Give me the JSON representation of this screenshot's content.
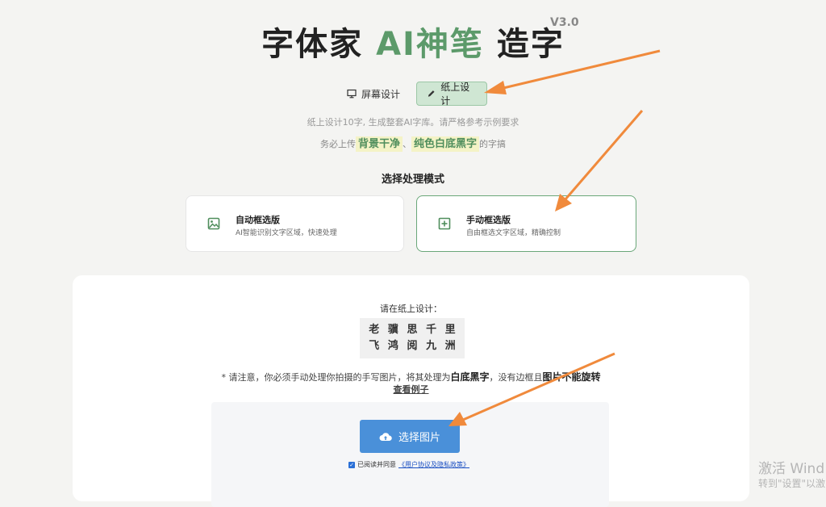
{
  "header": {
    "title_part1": "字体家 ",
    "title_ai": "AI神笔",
    "title_part2": " 造字",
    "version": "V3.0"
  },
  "tabs": [
    {
      "label": "屏幕设计",
      "icon": "monitor-icon",
      "active": false
    },
    {
      "label": "纸上设计",
      "icon": "pencil-icon",
      "active": true
    }
  ],
  "hints": {
    "line1": "纸上设计10字, 生成整套AI字库。请严格参考示例要求",
    "line2_prefix": "务必上传",
    "highlight1": "背景干净",
    "separator": "、",
    "highlight2": "纯色白底黑字",
    "line2_suffix": "的字搞"
  },
  "mode": {
    "heading": "选择处理模式",
    "options": [
      {
        "title": "自动框选版",
        "desc": "AI智能识别文字区域，快速处理",
        "icon": "image-icon",
        "selected": false
      },
      {
        "title": "手动框选版",
        "desc": "自由框选文字区域，精确控制",
        "icon": "plus-square-icon",
        "selected": true
      }
    ]
  },
  "upload": {
    "prompt": "请在纸上设计：",
    "chars_row1": [
      "老",
      "骥",
      "思",
      "千",
      "里"
    ],
    "chars_row2": [
      "飞",
      "鸿",
      "阅",
      "九",
      "洲"
    ],
    "note_prefix": "* 请注意，你必须手动处理你拍摄的手写图片，将其处理为",
    "note_bold1": "白底黑字",
    "note_mid": "，没有边框且",
    "note_bold2": "图片不能旋转",
    "example_link": "查看例子",
    "button_label": "选择图片",
    "agree_text": "已阅读并同意",
    "agree_link": "《用户协议及隐私政策》"
  },
  "watermark": {
    "line1": "激活 Wind",
    "line2": "转到\"设置\"以激"
  },
  "colors": {
    "accent_green": "#5c9a6a",
    "button_blue": "#4a90d9",
    "arrow_orange": "#f08a3c"
  }
}
